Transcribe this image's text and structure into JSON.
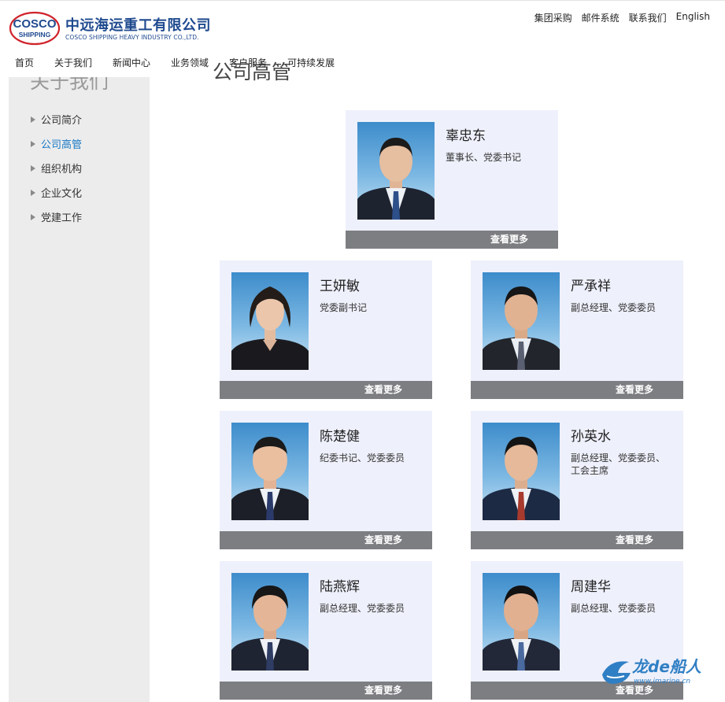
{
  "brand": {
    "logo_text": "COSCO SHIPPING",
    "name_cn": "中远海运重工有限公司",
    "name_en": "COSCO SHIPPING HEAVY INDUSTRY CO.,LTD."
  },
  "utility_links": [
    "集团采购",
    "邮件系统",
    "联系我们",
    "English"
  ],
  "nav": {
    "items": [
      "首页",
      "关于我们",
      "新闻中心",
      "业务领域",
      "客户服务",
      "可持续发展"
    ]
  },
  "sidebar": {
    "title": "关于我们",
    "items": [
      {
        "label": "公司简介",
        "active": false
      },
      {
        "label": "公司高管",
        "active": true
      },
      {
        "label": "组织机构",
        "active": false
      },
      {
        "label": "企业文化",
        "active": false
      },
      {
        "label": "党建工作",
        "active": false
      }
    ]
  },
  "main": {
    "title_stub": "公司高管"
  },
  "executives": [
    {
      "name": "辜忠东",
      "role": "董事长、党委书记",
      "more": "查看更多"
    },
    {
      "name": "王妍敏",
      "role": "党委副书记",
      "more": "查看更多"
    },
    {
      "name": "严承祥",
      "role": "副总经理、党委委员",
      "more": "查看更多"
    },
    {
      "name": "陈楚健",
      "role": "纪委书记、党委委员",
      "more": "查看更多"
    },
    {
      "name": "孙英水",
      "role": "副总经理、党委委员、工会主席",
      "more": "查看更多"
    },
    {
      "name": "陆燕辉",
      "role": "副总经理、党委委员",
      "more": "查看更多"
    },
    {
      "name": "周建华",
      "role": "副总经理、党委委员",
      "more": "查看更多"
    }
  ],
  "watermark": {
    "text": "龙de船人",
    "url": "www.imarine.cn"
  },
  "colors": {
    "brand_blue": "#1f4a8f",
    "brand_red": "#d0232b",
    "active_link": "#1a78c2",
    "card_bg": "#eef0fb",
    "more_bar": "#7d7e82",
    "sidebar_bg": "#ececed"
  }
}
